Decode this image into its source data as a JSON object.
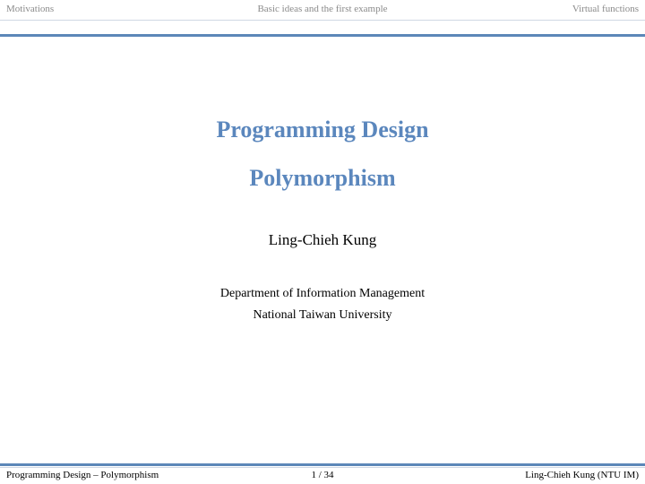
{
  "nav": {
    "left": "Motivations",
    "center": "Basic ideas and the first example",
    "right": "Virtual functions"
  },
  "title": {
    "line1": "Programming Design",
    "line2": "Polymorphism"
  },
  "author": "Ling-Chieh Kung",
  "institute": {
    "line1": "Department of Information Management",
    "line2": "National Taiwan University"
  },
  "footer": {
    "left": "Programming Design – Polymorphism",
    "center": "1 / 34",
    "right": "Ling-Chieh Kung (NTU IM)"
  },
  "colors": {
    "accent": "#5b87bd",
    "nav_text": "#8a8a8a",
    "rule": "#5c87b8"
  }
}
